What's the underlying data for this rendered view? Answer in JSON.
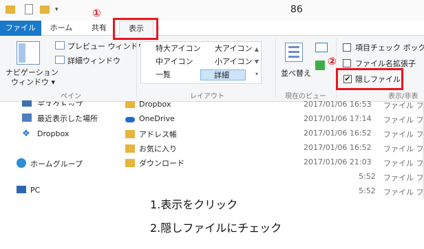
{
  "window": {
    "title": "86"
  },
  "tabs": [
    {
      "label": "ファイル"
    },
    {
      "label": "ホーム"
    },
    {
      "label": "共有"
    },
    {
      "label": "表示"
    }
  ],
  "ribbon": {
    "navigation_pane": {
      "label_line1": "ナビゲーション",
      "label_line2": "ウィンドウ ▾"
    },
    "preview_pane": "プレビュー ウィンドウ",
    "details_pane": "詳細ウィンドウ",
    "pane_group": "ペイン",
    "layout_items": [
      {
        "label": "特大アイコン"
      },
      {
        "label": "大アイコン"
      },
      {
        "label": "中アイコン"
      },
      {
        "label": "小アイコン"
      },
      {
        "label": "一覧"
      },
      {
        "label": "詳細"
      }
    ],
    "layout_group": "レイアウト",
    "sort_by": "並べ替え",
    "current_view_group": "現在のビュー",
    "item_checkbox": {
      "label": "項目チェック ボックス",
      "checked": false
    },
    "file_ext": {
      "label": "ファイル名拡張子",
      "checked": false
    },
    "hidden_files": {
      "label": "隠しファイル",
      "checked": true
    },
    "showhide_group": "表示/非表"
  },
  "nav_pane": [
    {
      "label": "デスクトップ",
      "icon": "desktop-icon"
    },
    {
      "label": "最近表示した場所",
      "icon": "recent-icon"
    },
    {
      "label": "Dropbox",
      "icon": "dropbox-icon"
    },
    {
      "label": "ホームグループ",
      "icon": "homegroup-icon"
    },
    {
      "label": "PC",
      "icon": "pc-icon"
    }
  ],
  "files": [
    {
      "name": "Dropbox",
      "date": "2017/01/06 16:53",
      "type": "ファイル フォ"
    },
    {
      "name": "OneDrive",
      "date": "2017/01/06 17:14",
      "type": "ファイル フォ"
    },
    {
      "name": "アドレス帳",
      "date": "2017/01/06 16:52",
      "type": "ファイル フォ"
    },
    {
      "name": "お気に入り",
      "date": "2017/01/06 16:52",
      "type": "ファイル フォ"
    },
    {
      "name": "ダウンロード",
      "date": "2017/01/06 21:03",
      "type": "ファイル フォ"
    },
    {
      "name": "",
      "date": "5:52",
      "type": "ファイル フォ"
    },
    {
      "name": "",
      "date": "5:52",
      "type": "ファイル フォ"
    }
  ],
  "annotations": {
    "marker1": "①",
    "marker2": "②",
    "step1": "1.表示をクリック",
    "step2": "2.隠しファイルにチェック",
    "highlight_color": "#e8141e"
  }
}
